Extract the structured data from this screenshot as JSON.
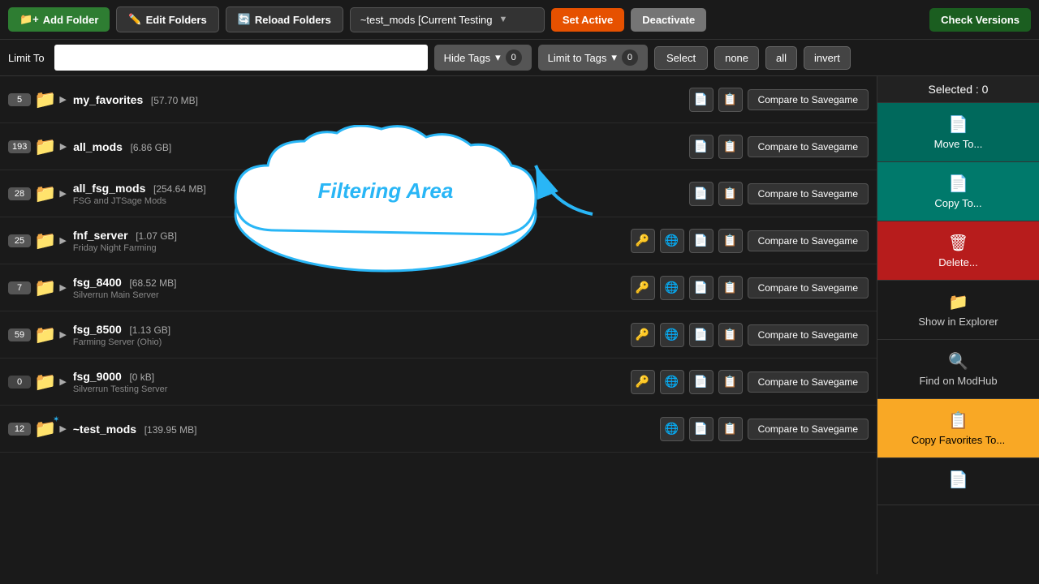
{
  "toolbar": {
    "add_folder": "Add Folder",
    "edit_folders": "Edit Folders",
    "reload_folders": "Reload Folders",
    "current_folder": "~test_mods [Current Testing",
    "set_active": "Set Active",
    "deactivate": "Deactivate",
    "check_versions": "Check Versions"
  },
  "filter_bar": {
    "limit_to_label": "Limit To",
    "limit_to_placeholder": "",
    "hide_tags": "Hide Tags",
    "hide_tags_count": "0",
    "limit_to_tags": "Limit to Tags",
    "limit_to_tags_count": "0",
    "select": "Select",
    "none": "none",
    "all": "all",
    "invert": "invert"
  },
  "selected": {
    "label": "Selected : 0"
  },
  "sidebar_buttons": [
    {
      "id": "move-to",
      "label": "Move To...",
      "icon": "📄",
      "style": "teal"
    },
    {
      "id": "copy-to",
      "label": "Copy To...",
      "icon": "📄",
      "style": "teal2"
    },
    {
      "id": "delete",
      "label": "Delete...",
      "icon": "🗑",
      "style": "red"
    },
    {
      "id": "show-explorer",
      "label": "Show in Explorer",
      "icon": "📁",
      "style": "dark"
    },
    {
      "id": "find-modhub",
      "label": "Find on ModHub",
      "icon": "🔍",
      "style": "dark"
    },
    {
      "id": "copy-favorites",
      "label": "Copy Favorites To...",
      "icon": "📋",
      "style": "gold"
    },
    {
      "id": "extra",
      "label": "",
      "icon": "📄",
      "style": "dark2"
    }
  ],
  "mods": [
    {
      "id": "my_favorites",
      "count": "5",
      "name": "my_favorites",
      "size": "[57.70 MB]",
      "subtitle": "",
      "has_key": false,
      "has_globe": false,
      "active": false,
      "special_icon": "⭐"
    },
    {
      "id": "all_mods",
      "count": "193",
      "name": "all_mods",
      "size": "[6.86 GB]",
      "subtitle": "",
      "has_key": false,
      "has_globe": false,
      "active": false
    },
    {
      "id": "all_fsg_mods",
      "count": "28",
      "name": "all_fsg_mods",
      "size": "[254.64 MB]",
      "subtitle": "FSG and JTSage Mods",
      "has_key": false,
      "has_globe": false,
      "active": false
    },
    {
      "id": "fnf_server",
      "count": "25",
      "name": "fnf_server",
      "size": "[1.07 GB]",
      "subtitle": "Friday Night Farming",
      "has_key": true,
      "has_globe": true,
      "active": false
    },
    {
      "id": "fsg_8400",
      "count": "7",
      "name": "fsg_8400",
      "size": "[68.52 MB]",
      "subtitle": "Silverrun Main Server",
      "has_key": true,
      "has_globe": true,
      "active": false
    },
    {
      "id": "fsg_8500",
      "count": "59",
      "name": "fsg_8500",
      "size": "[1.13 GB]",
      "subtitle": "Farming Server (Ohio)",
      "has_key": true,
      "has_globe": true,
      "active": false
    },
    {
      "id": "fsg_9000",
      "count": "0",
      "name": "fsg_9000",
      "size": "[0 kB]",
      "subtitle": "Silverrun Testing Server",
      "has_key": true,
      "has_globe": true,
      "active": false
    },
    {
      "id": "test_mods",
      "count": "12",
      "name": "~test_mods",
      "size": "[139.95 MB]",
      "subtitle": "",
      "has_key": false,
      "has_globe": true,
      "active": true
    }
  ],
  "filter_cloud": {
    "label": "Filtering Area"
  }
}
